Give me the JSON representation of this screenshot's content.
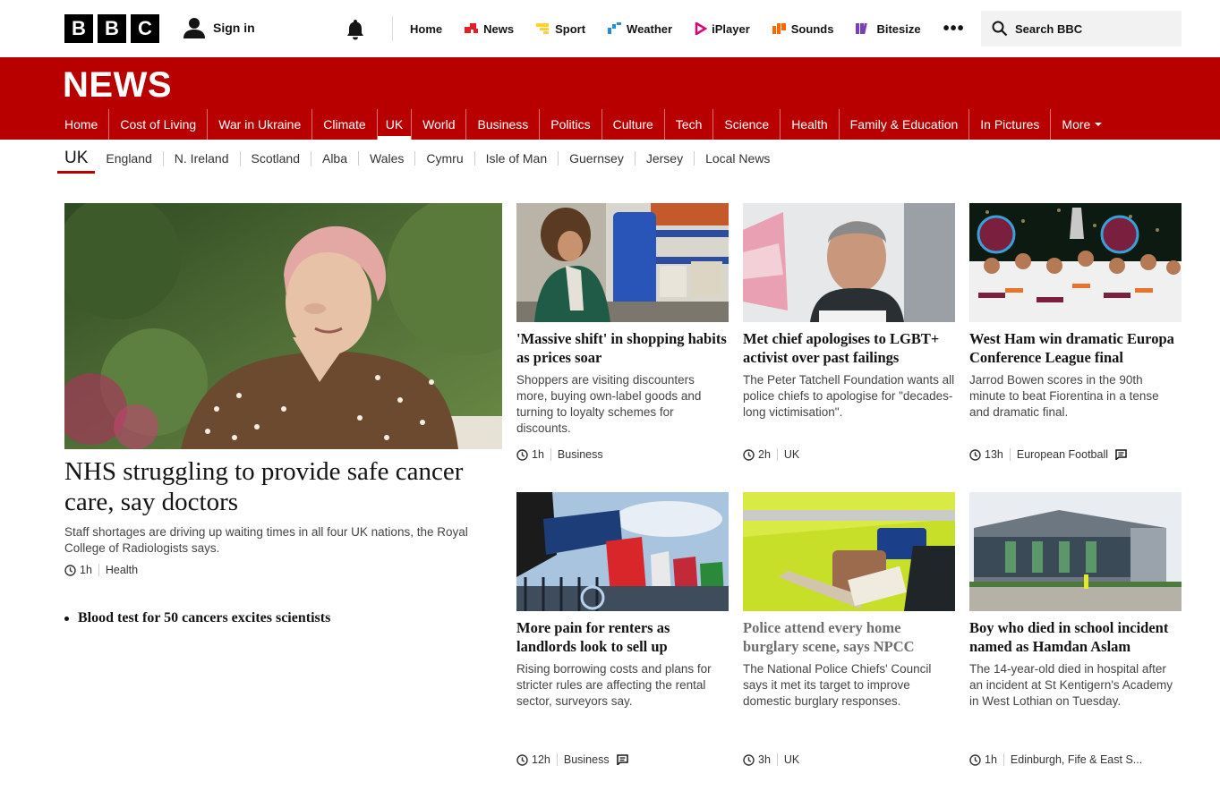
{
  "topbar": {
    "logo_letters": [
      "B",
      "B",
      "C"
    ],
    "signin": "Sign in",
    "nav": [
      {
        "label": "Home"
      },
      {
        "label": "News",
        "color": "#e41e26"
      },
      {
        "label": "Sport",
        "color": "#ffd230"
      },
      {
        "label": "Weather",
        "color": "#1d8fdb"
      },
      {
        "label": "iPlayer",
        "color": "#e0007a"
      },
      {
        "label": "Sounds",
        "color": "#ff6600"
      },
      {
        "label": "Bitesize",
        "color": "#7b3fb5"
      }
    ],
    "more": "•••",
    "search_placeholder": "Search BBC"
  },
  "news": {
    "title": "NEWS",
    "brand_color": "#b80000",
    "nav": [
      "Home",
      "Cost of Living",
      "War in Ukraine",
      "Climate",
      "UK",
      "World",
      "Business",
      "Politics",
      "Culture",
      "Tech",
      "Science",
      "Health",
      "Family & Education",
      "In Pictures",
      "More"
    ],
    "active": "UK"
  },
  "subnav": [
    "UK",
    "England",
    "N. Ireland",
    "Scotland",
    "Alba",
    "Wales",
    "Cymru",
    "Isle of Man",
    "Guernsey",
    "Jersey",
    "Local News"
  ],
  "lead": {
    "title": "NHS struggling to provide safe cancer care, say doctors",
    "summary": "Staff shortages are driving up waiting times in all four UK nations, the Royal College of Radiologists says.",
    "time": "1h",
    "tag": "Health",
    "related": "Blood test for 50 cancers excites scientists"
  },
  "cards": [
    {
      "title": "'Massive shift' in shopping habits as prices soar",
      "summary": "Shoppers are visiting discounters more, buying own-label goods and turning to loyalty schemes for discounts.",
      "time": "1h",
      "tag": "Business"
    },
    {
      "title": "Met chief apologises to LGBT+ activist over past failings",
      "summary": "The Peter Tatchell Foundation wants all police chiefs to apologise for \"decades-long victimisation\".",
      "time": "2h",
      "tag": "UK"
    },
    {
      "title": "West Ham win dramatic Europa Conference League final",
      "summary": "Jarrod Bowen scores in the 90th minute to beat Fiorentina in a tense and dramatic final.",
      "time": "13h",
      "tag": "European Football"
    },
    {
      "title": "More pain for renters as landlords look to sell up",
      "summary": "Rising borrowing costs and plans for stricter rules are affecting the rental sector, surveyors say.",
      "time": "12h",
      "tag": "Business"
    },
    {
      "title": "Police attend every home burglary scene, says NPCC",
      "summary": "The National Police Chiefs' Council says it met its target to improve domestic burglary responses.",
      "time": "3h",
      "tag": "UK"
    },
    {
      "title": "Boy who died in school incident named as Hamdan Aslam",
      "summary": "The 14-year-old died in hospital after an incident at St Kentigern's Academy in West Lothian on Tuesday.",
      "time": "1h",
      "tag": "Edinburgh, Fife & East S..."
    }
  ]
}
